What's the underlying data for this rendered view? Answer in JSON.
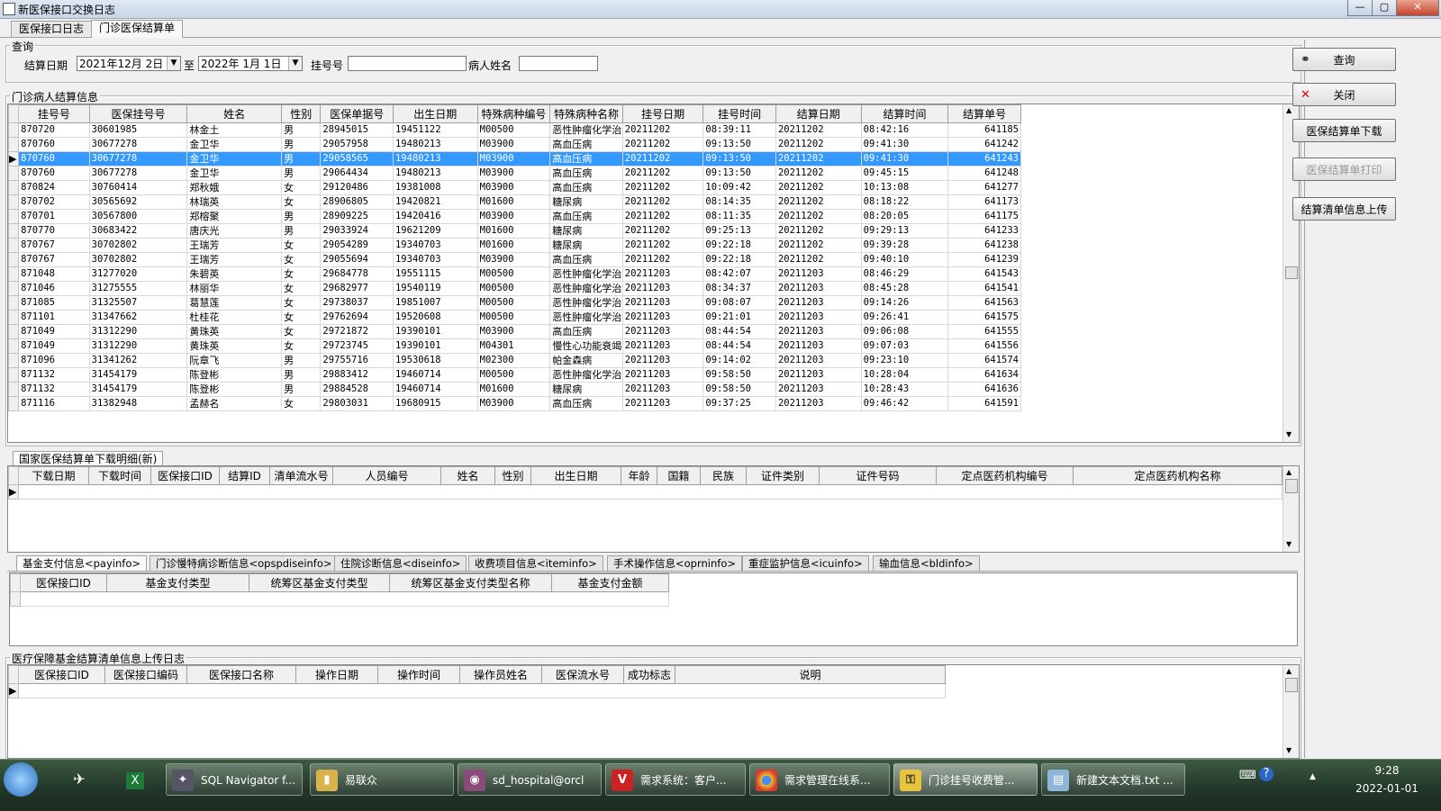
{
  "window": {
    "title": "新医保接口交换日志",
    "min_label": "—",
    "max_label": "▢",
    "close_label": "✕"
  },
  "main_tabs": [
    {
      "label": "医保接口日志"
    },
    {
      "label": "门诊医保结算单"
    }
  ],
  "query": {
    "group_label": "查询",
    "date_label": "结算日期",
    "date_from": "2021年12月 2日",
    "to_label": "至",
    "date_to": "2022年 1月 1日",
    "reg_label": "挂号号",
    "reg_value": "",
    "name_label": "病人姓名",
    "name_value": ""
  },
  "settlement": {
    "group_label": "门诊病人结算信息",
    "columns": [
      "挂号号",
      "医保挂号号",
      "姓名",
      "性别",
      "医保单据号",
      "出生日期",
      "特殊病种编号",
      "特殊病种名称",
      "挂号日期",
      "挂号时间",
      "结算日期",
      "结算时间",
      "结算单号"
    ],
    "selected_index": 2,
    "rows": [
      [
        "870720",
        "30601985",
        "林金土",
        "男",
        "28945015",
        "19451122",
        "M00500",
        "恶性肿瘤化学治",
        "20211202",
        "08:39:11",
        "20211202",
        "08:42:16",
        "641185"
      ],
      [
        "870760",
        "30677278",
        "金卫华",
        "男",
        "29057958",
        "19480213",
        "M03900",
        "高血压病",
        "20211202",
        "09:13:50",
        "20211202",
        "09:41:30",
        "641242"
      ],
      [
        "870760",
        "30677278",
        "金卫华",
        "男",
        "29058565",
        "19480213",
        "M03900",
        "高血压病",
        "20211202",
        "09:13:50",
        "20211202",
        "09:41:30",
        "641243"
      ],
      [
        "870760",
        "30677278",
        "金卫华",
        "男",
        "29064434",
        "19480213",
        "M03900",
        "高血压病",
        "20211202",
        "09:13:50",
        "20211202",
        "09:45:15",
        "641248"
      ],
      [
        "870824",
        "30760414",
        "郑秋娥",
        "女",
        "29120486",
        "19381008",
        "M03900",
        "高血压病",
        "20211202",
        "10:09:42",
        "20211202",
        "10:13:08",
        "641277"
      ],
      [
        "870702",
        "30565692",
        "林瑞英",
        "女",
        "28906805",
        "19420821",
        "M01600",
        "糖尿病",
        "20211202",
        "08:14:35",
        "20211202",
        "08:18:22",
        "641173"
      ],
      [
        "870701",
        "30567800",
        "郑榕聚",
        "男",
        "28909225",
        "19420416",
        "M03900",
        "高血压病",
        "20211202",
        "08:11:35",
        "20211202",
        "08:20:05",
        "641175"
      ],
      [
        "870770",
        "30683422",
        "唐庆光",
        "男",
        "29033924",
        "19621209",
        "M01600",
        "糖尿病",
        "20211202",
        "09:25:13",
        "20211202",
        "09:29:13",
        "641233"
      ],
      [
        "870767",
        "30702802",
        "王瑞芳",
        "女",
        "29054289",
        "19340703",
        "M01600",
        "糖尿病",
        "20211202",
        "09:22:18",
        "20211202",
        "09:39:28",
        "641238"
      ],
      [
        "870767",
        "30702802",
        "王瑞芳",
        "女",
        "29055694",
        "19340703",
        "M03900",
        "高血压病",
        "20211202",
        "09:22:18",
        "20211202",
        "09:40:10",
        "641239"
      ],
      [
        "871048",
        "31277020",
        "朱碧英",
        "女",
        "29684778",
        "19551115",
        "M00500",
        "恶性肿瘤化学治",
        "20211203",
        "08:42:07",
        "20211203",
        "08:46:29",
        "641543"
      ],
      [
        "871046",
        "31275555",
        "林丽华",
        "女",
        "29682977",
        "19540119",
        "M00500",
        "恶性肿瘤化学治",
        "20211203",
        "08:34:37",
        "20211203",
        "08:45:28",
        "641541"
      ],
      [
        "871085",
        "31325507",
        "葛慧莲",
        "女",
        "29738037",
        "19851007",
        "M00500",
        "恶性肿瘤化学治",
        "20211203",
        "09:08:07",
        "20211203",
        "09:14:26",
        "641563"
      ],
      [
        "871101",
        "31347662",
        "杜桂花",
        "女",
        "29762694",
        "19520608",
        "M00500",
        "恶性肿瘤化学治",
        "20211203",
        "09:21:01",
        "20211203",
        "09:26:41",
        "641575"
      ],
      [
        "871049",
        "31312290",
        "黄珠英",
        "女",
        "29721872",
        "19390101",
        "M03900",
        "高血压病",
        "20211203",
        "08:44:54",
        "20211203",
        "09:06:08",
        "641555"
      ],
      [
        "871049",
        "31312290",
        "黄珠英",
        "女",
        "29723745",
        "19390101",
        "M04301",
        "慢性心功能衰竭",
        "20211203",
        "08:44:54",
        "20211203",
        "09:07:03",
        "641556"
      ],
      [
        "871096",
        "31341262",
        "阮章飞",
        "男",
        "29755716",
        "19530618",
        "M02300",
        "帕金森病",
        "20211203",
        "09:14:02",
        "20211203",
        "09:23:10",
        "641574"
      ],
      [
        "871132",
        "31454179",
        "陈登彬",
        "男",
        "29883412",
        "19460714",
        "M00500",
        "恶性肿瘤化学治",
        "20211203",
        "09:58:50",
        "20211203",
        "10:28:04",
        "641634"
      ],
      [
        "871132",
        "31454179",
        "陈登彬",
        "男",
        "29884528",
        "19460714",
        "M01600",
        "糖尿病",
        "20211203",
        "09:58:50",
        "20211203",
        "10:28:43",
        "641636"
      ],
      [
        "871116",
        "31382948",
        "孟赫名",
        "女",
        "29803031",
        "19680915",
        "M03900",
        "高血压病",
        "20211203",
        "09:37:25",
        "20211203",
        "09:46:42",
        "641591"
      ]
    ]
  },
  "download": {
    "tab_label": "国家医保结算单下载明细(新)",
    "columns": [
      "下载日期",
      "下载时间",
      "医保接口ID",
      "结算ID",
      "清单流水号",
      "人员编号",
      "姓名",
      "性别",
      "出生日期",
      "年龄",
      "国籍",
      "民族",
      "证件类别",
      "证件号码",
      "定点医药机构编号",
      "定点医药机构名称"
    ]
  },
  "sub_tabs": [
    {
      "label": "基金支付信息<payinfo>"
    },
    {
      "label": "门诊慢特病诊断信息<opspdiseinfo>"
    },
    {
      "label": "住院诊断信息<diseinfo>"
    },
    {
      "label": "收费项目信息<iteminfo>"
    },
    {
      "label": "手术操作信息<oprninfo>"
    },
    {
      "label": "重症监护信息<icuinfo>"
    },
    {
      "label": "输血信息<bldinfo>"
    }
  ],
  "fund": {
    "columns": [
      "医保接口ID",
      "基金支付类型",
      "统筹区基金支付类型",
      "统筹区基金支付类型名称",
      "基金支付金额"
    ]
  },
  "upload_log": {
    "group_label": "医疗保障基金结算清单信息上传日志",
    "columns": [
      "医保接口ID",
      "医保接口编码",
      "医保接口名称",
      "操作日期",
      "操作时间",
      "操作员姓名",
      "医保流水号",
      "成功标志",
      "说明"
    ]
  },
  "buttons": {
    "query": "查询",
    "close": "关闭",
    "download": "医保结算单下载",
    "print": "医保结算单打印",
    "upload": "结算清单信息上传"
  },
  "taskbar": {
    "items": [
      {
        "label": "SQL Navigator f..."
      },
      {
        "label": "易联众"
      },
      {
        "label": "sd_hospital@orcl"
      },
      {
        "label": "需求系统：客户..."
      },
      {
        "label": "需求管理在线系..."
      },
      {
        "label": "门诊挂号收费管..."
      },
      {
        "label": "新建文本文档.txt ..."
      }
    ],
    "time": "9:28",
    "date": "2022-01-01"
  }
}
